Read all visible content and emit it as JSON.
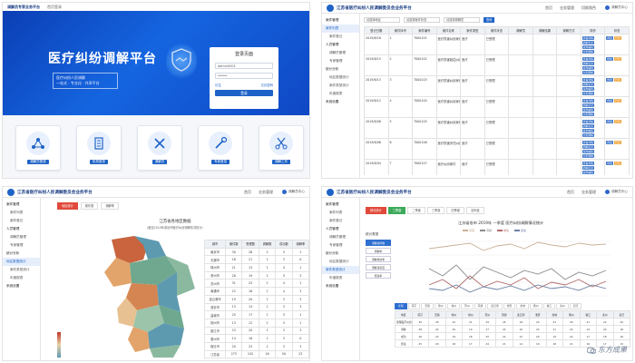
{
  "login": {
    "header_title": "调解员专家业务平台",
    "header_link": "首页登录",
    "banner_title": "医疗纠纷调解平台",
    "banner_sub_1": "医疗纠纷人民调解",
    "banner_sub_2": "一站式 · 专业化 · 共享平台",
    "panel_title": "登录页面",
    "username_value": "admin0001",
    "password_value": "******",
    "remember_label": "记住",
    "forgot_label": "忘记密码",
    "login_button": "登录",
    "tiles": [
      "调解员登录",
      "机构登录",
      "调解员",
      "专家登录",
      "调解工作"
    ]
  },
  "cases": {
    "app_title": "江苏省医疗纠纷人民调解委员会业务平台",
    "nav": [
      "首页",
      "业务管理",
      "切换角色"
    ],
    "user": "调解员中心",
    "sidebar": [
      {
        "label": "案件管理",
        "type": "grp"
      },
      {
        "label": "案件列表",
        "type": "act"
      },
      {
        "label": "案件登记",
        "type": "sub"
      },
      {
        "label": "人员管理",
        "type": "grp"
      },
      {
        "label": "调解员管理",
        "type": "sub"
      },
      {
        "label": "专家管理",
        "type": "sub"
      },
      {
        "label": "统计分析",
        "type": "grp"
      },
      {
        "label": "地区数据统计",
        "type": "sub"
      },
      {
        "label": "案件类型统计",
        "type": "sub"
      },
      {
        "label": "年度报表",
        "type": "sub"
      },
      {
        "label": "系统设置",
        "type": "grp"
      }
    ],
    "filters": [
      "请选择地区",
      "请选择案件状态",
      "请选择调解员"
    ],
    "search_button": "查询",
    "headers": [
      "登记日期",
      "案件序号",
      "案件编号",
      "案件名称",
      "案件类型",
      "案件状态",
      "调解员",
      "调解结果",
      "调解方式",
      "操作",
      "状态"
    ],
    "rows": [
      [
        "2019/6/16",
        "1",
        "T000101",
        "医疗损害纠纷案件",
        "医疗",
        "已受理",
        "",
        "",
        "",
        "",
        ""
      ],
      [
        "2019/6/15",
        "2",
        "T000102",
        "医疗损害赔偿纠纷案件",
        "医疗",
        "已受理",
        "",
        "",
        "",
        "",
        ""
      ],
      [
        "2019/6/13",
        "3",
        "T000103",
        "医疗损害纠纷案件",
        "医疗",
        "已受理",
        "",
        "",
        "",
        "",
        ""
      ],
      [
        "2019/6/12",
        "4",
        "T000104",
        "医疗损害纠纷案件",
        "医疗",
        "已受理",
        "",
        "",
        "",
        "",
        ""
      ],
      [
        "2019/6/08",
        "5",
        "T000105",
        "医疗损害纠纷案件",
        "医疗",
        "已受理",
        "",
        "",
        "",
        "",
        ""
      ],
      [
        "2019/6/06",
        "6",
        "T000106",
        "医疗损害责任纠纷案件",
        "医疗",
        "已受理",
        "",
        "",
        "",
        "",
        ""
      ],
      [
        "2019/6/04",
        "7",
        "T000107",
        "医疗纠纷案件",
        "医疗",
        "已受理",
        "",
        "",
        "",
        "",
        ""
      ]
    ],
    "op_buttons": [
      "查看详情",
      "调解记录",
      "案件编辑",
      "分配调解"
    ],
    "status_label": "修改",
    "status_alt": "已结"
  },
  "region": {
    "app_title": "江苏省医疗纠纷人民调解委员会业务平台",
    "nav": [
      "首页",
      "业务管理"
    ],
    "user": "调解员中心",
    "tabs": [
      "地区统计",
      "案件数",
      "调解率"
    ],
    "title": "江苏省各地区数据",
    "subtitle": "（截至2019年各地市医疗纠纷调解情况统计）",
    "headers": [
      "城市",
      "案件数",
      "受理数",
      "调解数",
      "成功数",
      "调解率"
    ],
    "rows": [
      [
        "南京市",
        "30",
        "26",
        "2",
        "5",
        "1"
      ],
      [
        "无锡市",
        "16",
        "21",
        "1",
        "3",
        "0"
      ],
      [
        "徐州市",
        "21",
        "13",
        "1",
        "4",
        "1"
      ],
      [
        "常州市",
        "26",
        "19",
        "1",
        "5",
        "3"
      ],
      [
        "苏州市",
        "31",
        "25",
        "2",
        "4",
        "1"
      ],
      [
        "南通市",
        "22",
        "16",
        "1",
        "4",
        "3"
      ],
      [
        "连云港市",
        "19",
        "20",
        "1",
        "3",
        "3"
      ],
      [
        "淮安市",
        "13",
        "14",
        "1",
        "3",
        "3"
      ],
      [
        "盐城市",
        "25",
        "17",
        "1",
        "5",
        "1"
      ],
      [
        "扬州市",
        "13",
        "12",
        "2",
        "5",
        "1"
      ],
      [
        "镇江市",
        "23",
        "20",
        "1",
        "3",
        "3"
      ],
      [
        "泰州市",
        "14",
        "16",
        "1",
        "3",
        "0"
      ],
      [
        "宿迁市",
        "20",
        "23",
        "1",
        "3",
        "3"
      ],
      [
        "江苏省",
        "273",
        "242",
        "16",
        "50",
        "23"
      ]
    ]
  },
  "trend": {
    "app_title": "江苏省医疗纠纷人民调解委员会业务平台",
    "nav": [
      "首页",
      "业务管理"
    ],
    "user": "调解员中心",
    "tabs": [
      "按月统计",
      "三季度",
      "二季度",
      "三季度",
      "四季度",
      "全年度"
    ],
    "chart_title": "江苏省各市 2019年 一季度 医疗纠纷调解情况统计",
    "legend": [
      "受理",
      "调解",
      "成功",
      "结案"
    ],
    "stat_label": "统计类型",
    "list": [
      "调解案件数",
      "调解率",
      "调解成功率",
      "调解满意度",
      "结案率"
    ],
    "bottom_tabs": [
      "全部",
      "南京",
      "无锡",
      "徐州",
      "常州",
      "苏州",
      "南通",
      "连云港",
      "淮安",
      "盐城",
      "扬州",
      "镇江",
      "泰州",
      "宿迁"
    ],
    "table_headers": [
      "地区",
      "南京",
      "无锡",
      "徐州",
      "常州",
      "苏州",
      "南通",
      "连云港",
      "淮安",
      "盐城",
      "扬州",
      "镇江",
      "泰州",
      "宿迁"
    ],
    "table_rows": [
      [
        "受理医疗纠纷",
        "30",
        "26",
        "22",
        "21",
        "29",
        "26",
        "18",
        "24",
        "23",
        "26",
        "21",
        "22",
        "20"
      ],
      [
        "调解",
        "28",
        "24",
        "20",
        "19",
        "27",
        "24",
        "16",
        "22",
        "21",
        "24",
        "19",
        "20",
        "18"
      ],
      [
        "成功",
        "26",
        "22",
        "19",
        "18",
        "25",
        "22",
        "15",
        "20",
        "19",
        "22",
        "17",
        "18",
        "16"
      ],
      [
        "结案",
        "25",
        "20",
        "18",
        "17",
        "24",
        "21",
        "14",
        "19",
        "18",
        "21",
        "16",
        "17",
        "15"
      ]
    ]
  },
  "watermark": "东方成果"
}
